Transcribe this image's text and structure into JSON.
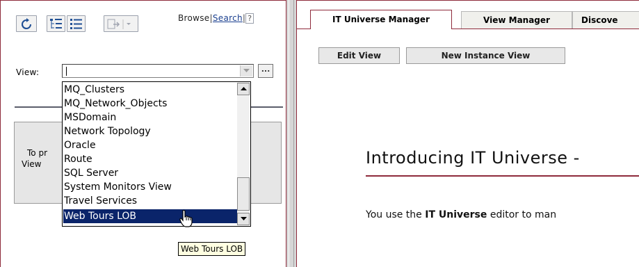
{
  "left_panel": {
    "toolbar": {
      "refresh_icon": "refresh-icon",
      "tree_view_icon": "tree-view-icon",
      "list_view_icon": "list-view-icon",
      "action_menu_icon": "action-menu-icon",
      "browse_label": "Browse",
      "separator": "|",
      "search_label": "Search",
      "help_label": "?"
    },
    "view_label": "View:",
    "view_value": "",
    "browse_button_label": "...",
    "info_line_1": "To pr",
    "info_line_2": "View",
    "dropdown": {
      "items": [
        "MQ_Clusters",
        "MQ_Network_Objects",
        "MSDomain",
        "Network Topology",
        "Oracle",
        "Route",
        "SQL Server",
        "System Monitors View",
        "Travel Services",
        "Web Tours LOB"
      ],
      "selected_index": 9
    },
    "tooltip": "Web Tours LOB"
  },
  "right_panel": {
    "tabs": [
      {
        "label": "IT Universe Manager",
        "active": true
      },
      {
        "label": "View Manager",
        "active": false
      },
      {
        "label": "Discove",
        "active": false
      }
    ],
    "buttons": {
      "edit_view": "Edit View",
      "new_instance_view": "New Instance View"
    },
    "intro_heading": "Introducing IT Universe -",
    "intro_prefix": "You use the ",
    "intro_bold": "IT Universe",
    "intro_suffix": " editor to man"
  },
  "colors": {
    "accent_border": "#8e2a3b",
    "selection": "#0a246a",
    "tooltip_bg": "#ffffe1"
  }
}
